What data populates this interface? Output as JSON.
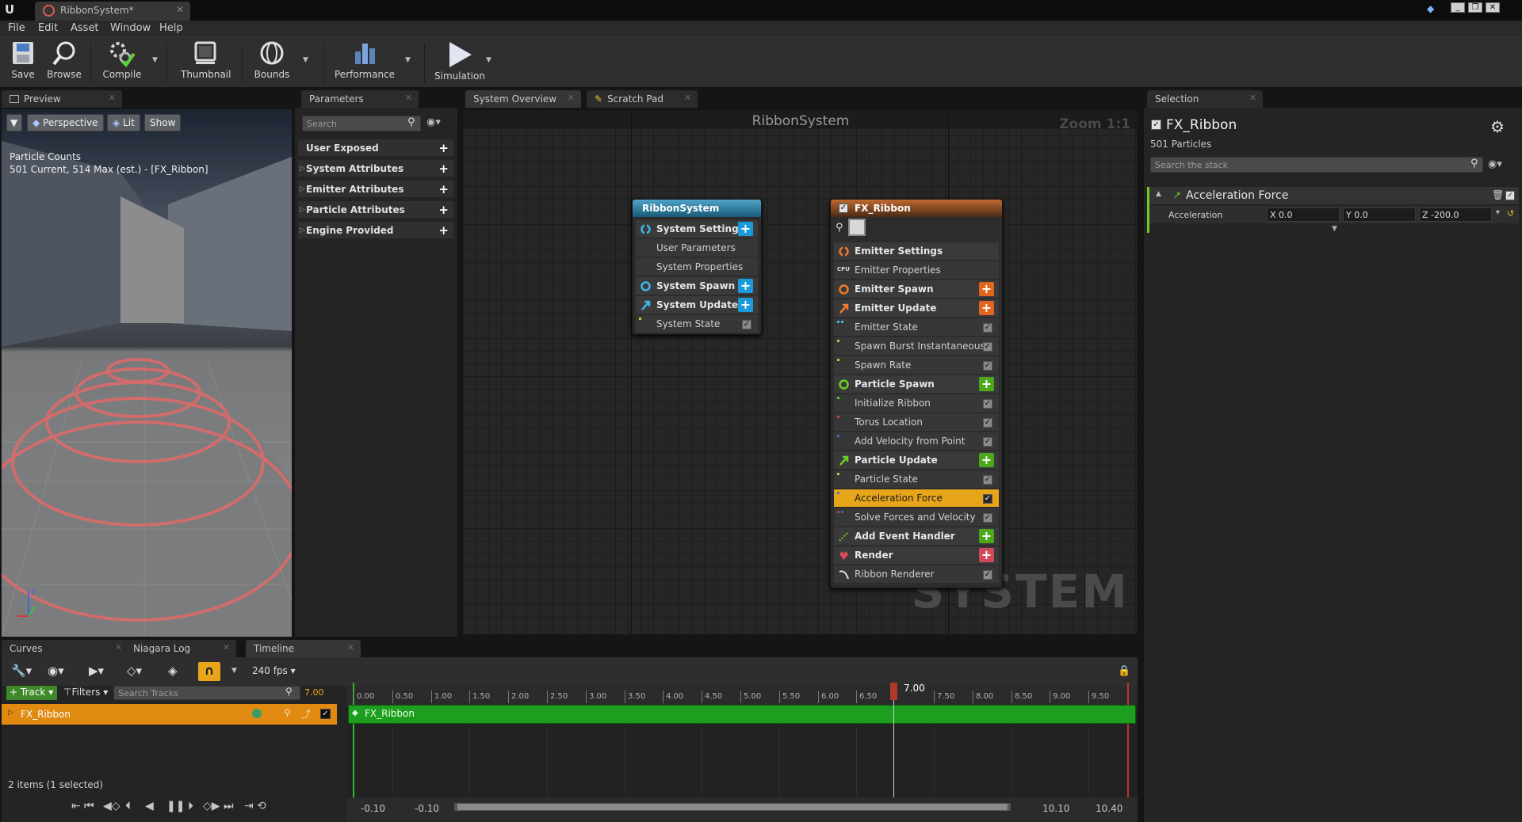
{
  "window": {
    "tab_title": "RibbonSystem*",
    "buttons": [
      "_",
      "❐",
      "✕"
    ]
  },
  "menu": [
    "File",
    "Edit",
    "Asset",
    "Window",
    "Help"
  ],
  "toolbar": {
    "save": "Save",
    "browse": "Browse",
    "compile": "Compile",
    "thumbnail": "Thumbnail",
    "bounds": "Bounds",
    "performance": "Performance",
    "simulation": "Simulation"
  },
  "preview": {
    "tab": "Preview",
    "perspective": "Perspective",
    "lit": "Lit",
    "show": "Show",
    "counts_title": "Particle Counts",
    "counts_line": "501 Current, 514 Max (est.) - [FX_Ribbon]"
  },
  "parameters": {
    "tab": "Parameters",
    "search_placeholder": "Search",
    "groups": [
      "User Exposed",
      "System Attributes",
      "Emitter Attributes",
      "Particle Attributes",
      "Engine Provided"
    ]
  },
  "graph": {
    "tab_overview": "System Overview",
    "tab_scratch": "Scratch Pad",
    "title": "RibbonSystem",
    "zoom": "Zoom 1:1",
    "watermark": "SYSTEM",
    "system_node": {
      "title": "RibbonSystem",
      "rows": [
        "System Settings",
        "User Parameters",
        "System Properties",
        "System Spawn",
        "System Update",
        "System State"
      ]
    },
    "emitter_node": {
      "title": "FX_Ribbon",
      "rows": [
        "Emitter Settings",
        "Emitter Properties",
        "Emitter Spawn",
        "Emitter Update",
        "Emitter State",
        "Spawn Burst Instantaneous",
        "Spawn Rate",
        "Particle Spawn",
        "Initialize Ribbon",
        "Torus Location",
        "Add Velocity from Point",
        "Particle Update",
        "Particle State",
        "Acceleration Force",
        "Solve Forces and Velocity",
        "Add Event Handler",
        "Render",
        "Ribbon Renderer"
      ],
      "selected": "Acceleration Force"
    }
  },
  "selection": {
    "tab": "Selection",
    "title": "FX_Ribbon",
    "count": "501 Particles",
    "search_placeholder": "Search the stack",
    "module": "Acceleration Force",
    "param_label": "Acceleration",
    "x": "X 0.0",
    "y": "Y 0.0",
    "z": "Z -200.0"
  },
  "bottom": {
    "tab_curves": "Curves",
    "tab_log": "Niagara Log",
    "tab_timeline": "Timeline",
    "fps": "240 fps",
    "track_btn": "Track",
    "filters_btn": "Filters",
    "search_placeholder": "Search Tracks",
    "time_value": "7.00",
    "track_name": "FX_Ribbon",
    "items_status": "2 items (1 selected)",
    "playhead": "7.00",
    "ticks": [
      "0.00",
      "0.50",
      "1.00",
      "1.50",
      "2.00",
      "2.50",
      "3.00",
      "3.50",
      "4.00",
      "4.50",
      "5.00",
      "5.50",
      "6.00",
      "6.50",
      "7.50",
      "8.00",
      "8.50",
      "9.00",
      "9.50"
    ],
    "range_start_a": "-0.10",
    "range_start_b": "-0.10",
    "range_end_a": "10.10",
    "range_end_b": "10.40"
  }
}
